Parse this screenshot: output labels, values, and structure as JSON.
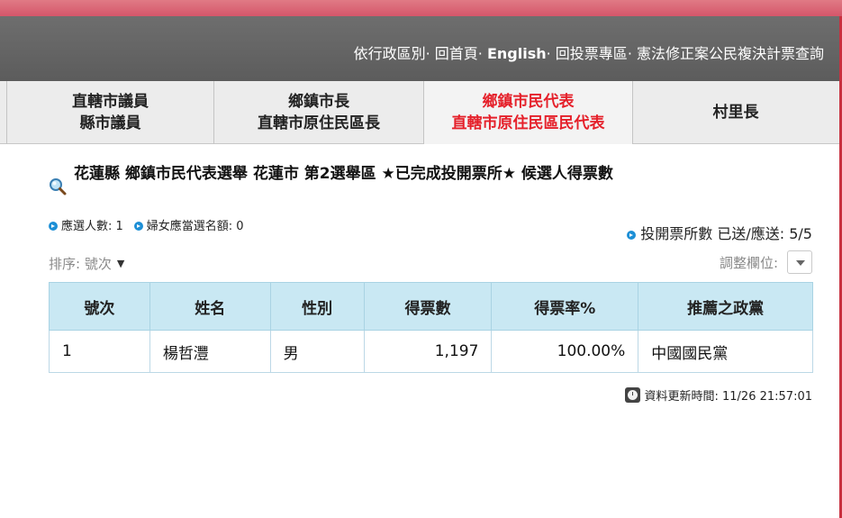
{
  "header": {
    "links": [
      "依行政區別",
      "回首頁",
      "English",
      "回投票專區",
      "憲法修正案公民複決計票查詢"
    ],
    "separator": "· "
  },
  "tabs": [
    {
      "line1": "直轄市議員",
      "line2": "縣市議員",
      "active": false
    },
    {
      "line1": "鄉鎮市長",
      "line2": "直轄市原住民區長",
      "active": false
    },
    {
      "line1": "鄉鎮市民代表",
      "line2": "直轄市原住民區民代表",
      "active": true
    },
    {
      "line1": "村里長",
      "line2": "",
      "active": false
    }
  ],
  "title": "花蓮縣 鄉鎮市民代表選舉 花蓮市 第2選舉區 ★已完成投開票所★ 候選人得票數",
  "info": {
    "elect_count": "應選人數: 1",
    "women_quota": "婦女應當選名額: 0",
    "stations": "投開票所數 已送/應送: 5/5"
  },
  "sort": {
    "label": "排序:",
    "value": "號次"
  },
  "adjust_label": "調整欄位:",
  "table": {
    "headers": [
      "號次",
      "姓名",
      "性別",
      "得票數",
      "得票率%",
      "推薦之政黨"
    ],
    "rows": [
      {
        "no": "1",
        "name": "楊哲灃",
        "gender": "男",
        "votes": "1,197",
        "rate": "100.00%",
        "party": "中國國民黨"
      }
    ]
  },
  "update_time": "資料更新時間: 11/26 21:57:01",
  "colors": {
    "header_bg": "#666666",
    "top_strip": "#d5566a",
    "active_tab": "#e5202a",
    "table_header": "#c9e8f3",
    "dot": "#1d8fd6"
  },
  "icons": [
    "search-icon",
    "info-dot-icon",
    "chevron-down-icon",
    "clock-icon"
  ]
}
